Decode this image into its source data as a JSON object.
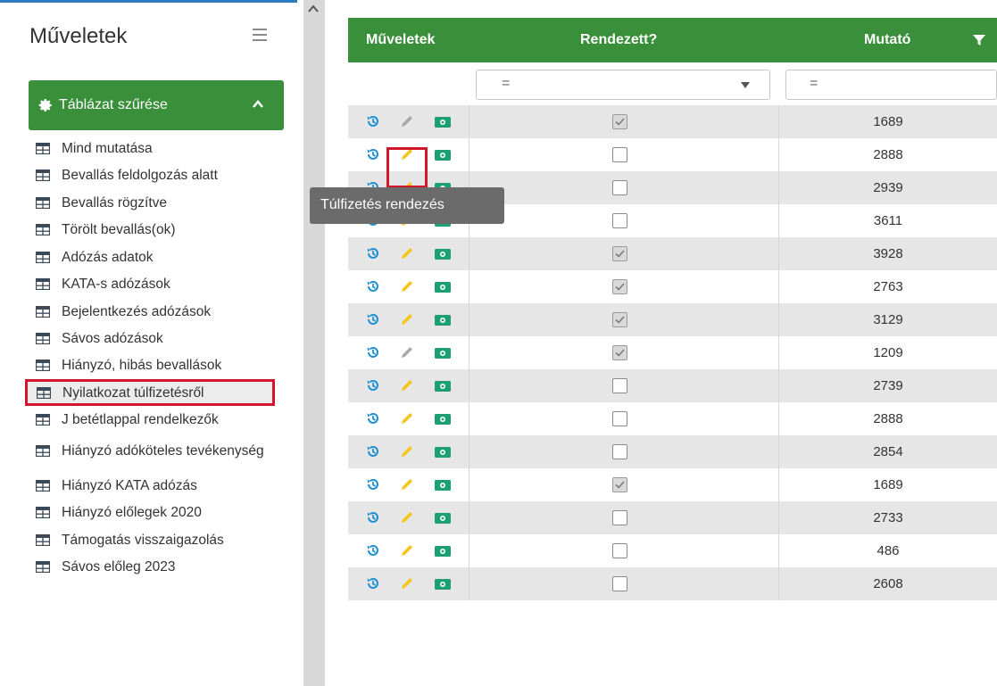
{
  "sidebar": {
    "title": "Műveletek",
    "filter_button": "Táblázat szűrése",
    "items": [
      {
        "label": "Mind mutatása"
      },
      {
        "label": "Bevallás feldolgozás alatt"
      },
      {
        "label": "Bevallás rögzítve"
      },
      {
        "label": "Törölt bevallás(ok)"
      },
      {
        "label": "Adózás adatok"
      },
      {
        "label": "KATA-s adózások"
      },
      {
        "label": "Bejelentkezés adózások"
      },
      {
        "label": "Sávos adózások"
      },
      {
        "label": "Hiányzó, hibás bevallások"
      },
      {
        "label": "Nyilatkozat túlfizetésről"
      },
      {
        "label": "J betétlappal rendelkezők"
      },
      {
        "label": "Hiányzó adóköteles tevékenység"
      },
      {
        "label": "Hiányzó KATA adózás"
      },
      {
        "label": "Hiányzó előlegek 2020"
      },
      {
        "label": "Támogatás visszaigazolás"
      },
      {
        "label": "Sávos előleg 2023"
      }
    ]
  },
  "table": {
    "columns": {
      "ops": "Műveletek",
      "rendezett": "Rendezett?",
      "mutato": "Mutató"
    },
    "filters": {
      "rendezett": "=",
      "mutato": "="
    },
    "rows": [
      {
        "rendezett": true,
        "mutato": "1689",
        "edit_enabled": false
      },
      {
        "rendezett": false,
        "mutato": "2888",
        "edit_enabled": true
      },
      {
        "rendezett": false,
        "mutato": "2939",
        "edit_enabled": true
      },
      {
        "rendezett": false,
        "mutato": "3611",
        "edit_enabled": true
      },
      {
        "rendezett": true,
        "mutato": "3928",
        "edit_enabled": true
      },
      {
        "rendezett": true,
        "mutato": "2763",
        "edit_enabled": true
      },
      {
        "rendezett": true,
        "mutato": "3129",
        "edit_enabled": true
      },
      {
        "rendezett": true,
        "mutato": "1209",
        "edit_enabled": false
      },
      {
        "rendezett": false,
        "mutato": "2739",
        "edit_enabled": true
      },
      {
        "rendezett": false,
        "mutato": "2888",
        "edit_enabled": true
      },
      {
        "rendezett": false,
        "mutato": "2854",
        "edit_enabled": true
      },
      {
        "rendezett": true,
        "mutato": "1689",
        "edit_enabled": true
      },
      {
        "rendezett": false,
        "mutato": "2733",
        "edit_enabled": true
      },
      {
        "rendezett": false,
        "mutato": "486",
        "edit_enabled": true
      },
      {
        "rendezett": false,
        "mutato": "2608",
        "edit_enabled": true
      }
    ]
  },
  "tooltip": "Túlfizetés rendezés",
  "colors": {
    "header_green": "#3a8f3a",
    "history_blue": "#1f8fd1",
    "edit_yellow": "#f5c518",
    "edit_disabled": "#a8a8a8",
    "cash_green": "#1c9f73",
    "highlight_red": "#d0182a"
  },
  "icons": {
    "history": "history-icon",
    "edit": "pencil-icon",
    "cash": "money-icon",
    "filter": "funnel-icon"
  }
}
